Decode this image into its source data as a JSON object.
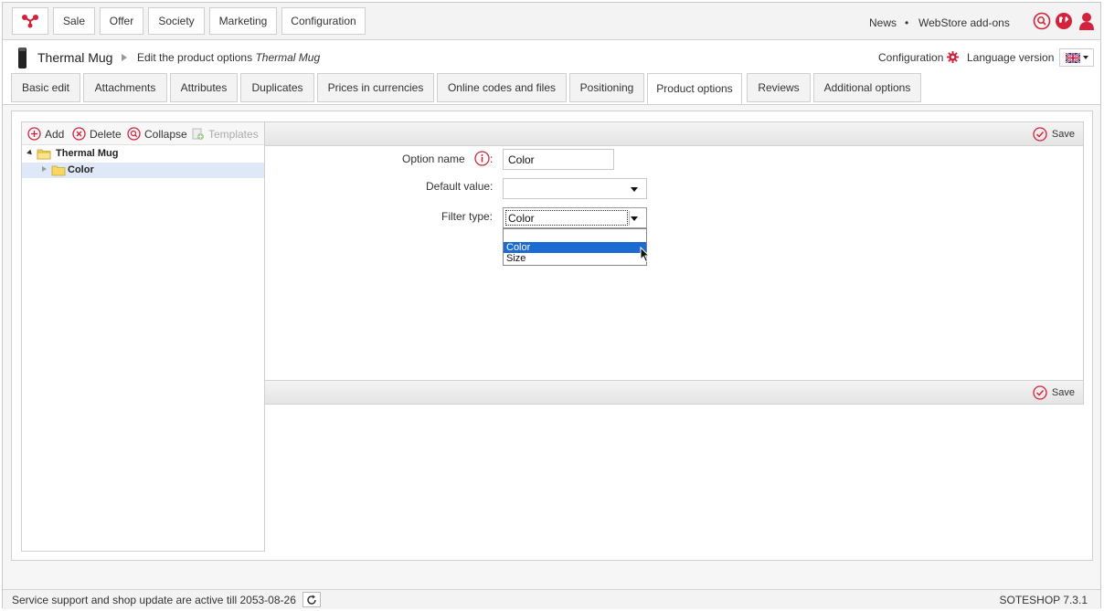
{
  "nav": {
    "items": [
      "Sale",
      "Offer",
      "Society",
      "Marketing",
      "Configuration"
    ],
    "news": "News",
    "separator": "•",
    "addons": "WebStore add-ons"
  },
  "header": {
    "product": "Thermal Mug",
    "subtitle_prefix": "Edit the product options",
    "subtitle_product": "Thermal Mug",
    "configuration": "Configuration",
    "language_version": "Language version"
  },
  "tabs": [
    {
      "label": "Basic edit"
    },
    {
      "label": "Attachments"
    },
    {
      "label": "Attributes"
    },
    {
      "label": "Duplicates"
    },
    {
      "label": "Prices in currencies"
    },
    {
      "label": "Online codes and files"
    },
    {
      "label": "Positioning"
    },
    {
      "label": "Product options",
      "active": true
    },
    {
      "label": "Reviews"
    },
    {
      "label": "Additional options"
    }
  ],
  "tree_toolbar": {
    "add": "Add",
    "delete": "Delete",
    "collapse": "Collapse",
    "templates": "Templates"
  },
  "tree": {
    "root": "Thermal Mug",
    "child": "Color"
  },
  "form": {
    "save": "Save",
    "option_name_label": "Option name",
    "option_name_colon": ":",
    "option_name_value": "Color",
    "default_value_label": "Default value:",
    "default_value": "",
    "filter_type_label": "Filter type:",
    "filter_type_value": "Color",
    "filter_options": [
      "",
      "Color",
      "Size"
    ]
  },
  "footer": {
    "service": "Service support and shop update are active till 2053-08-26",
    "version": "SOTESHOP 7.3.1"
  },
  "colors": {
    "accent_red": "#d3223b",
    "highlight_blue": "#1b6bd1",
    "tree_selected": "#dfe8f6"
  }
}
